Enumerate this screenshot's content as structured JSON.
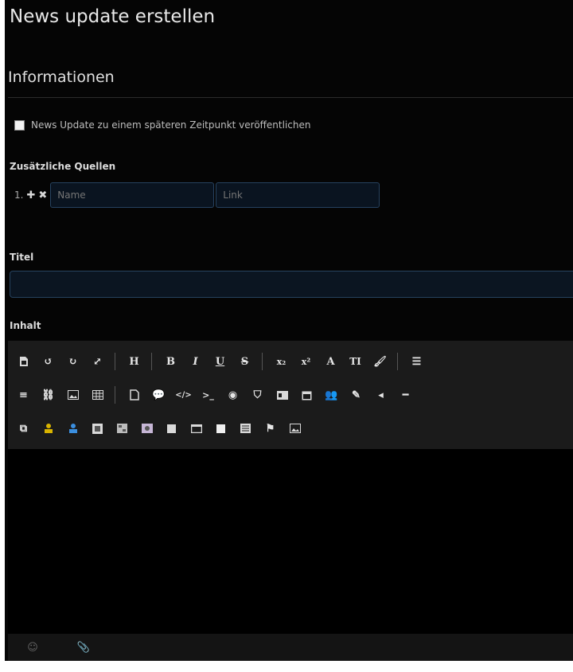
{
  "page": {
    "title": "News update erstellen"
  },
  "section": {
    "title": "Informationen"
  },
  "schedule": {
    "label": "News Update zu einem späteren Zeitpunkt veröffentlichen"
  },
  "sources": {
    "label": "Zusätzliche Quellen",
    "index": "1.",
    "add_icon": "plus-icon",
    "remove_icon": "times-icon",
    "name_placeholder": "Name",
    "link_placeholder": "Link"
  },
  "title_field": {
    "label": "Titel",
    "value": ""
  },
  "content": {
    "label": "Inhalt"
  },
  "toolbar": {
    "heading_label": "H",
    "bold_label": "B",
    "italic_label": "I",
    "underline_label": "U",
    "strike_label": "S",
    "subscript_label": "x₂",
    "superscript_label": "x²",
    "font_label": "A",
    "textsize_label": "TI",
    "accent_color_yellow": "#d9b400",
    "accent_color_blue": "#3b8fe0"
  }
}
